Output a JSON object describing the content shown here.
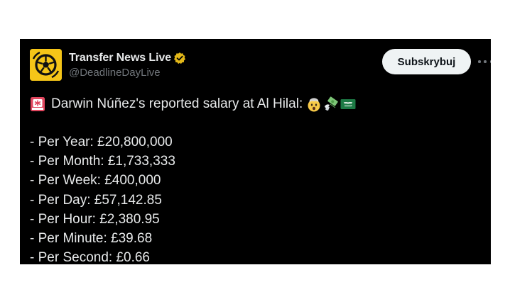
{
  "tweet": {
    "author": {
      "display_name": "Transfer News Live",
      "handle": "@DeadlineDayLive",
      "verified": true,
      "avatar_icon": "soccer-ball-logo-icon",
      "avatar_color": "#f5c518"
    },
    "subscribe_label": "Subskrybuj",
    "more_icon": "more-options-icon",
    "headline": "Darwin Núñez's reported salary at Al Hilal:",
    "headline_emojis": [
      "siren-icon",
      "exploding-head-icon",
      "money-with-wings-icon",
      "saudi-flag-icon"
    ],
    "salary_lines": [
      "- Per Year: £20,800,000",
      "- Per Month: £1,733,333",
      "- Per Week: £400,000",
      "- Per Day: £57,142.85",
      "- Per Hour: £2,380.95",
      "- Per Minute: £39.68",
      "- Per Second: £0.66"
    ]
  },
  "colors": {
    "card_background": "#000000",
    "primary_text": "#e7e9ea",
    "secondary_text": "#71767b",
    "button_background": "#eff3f4",
    "button_text": "#0f1419",
    "verified_badge": "#e2b719"
  }
}
